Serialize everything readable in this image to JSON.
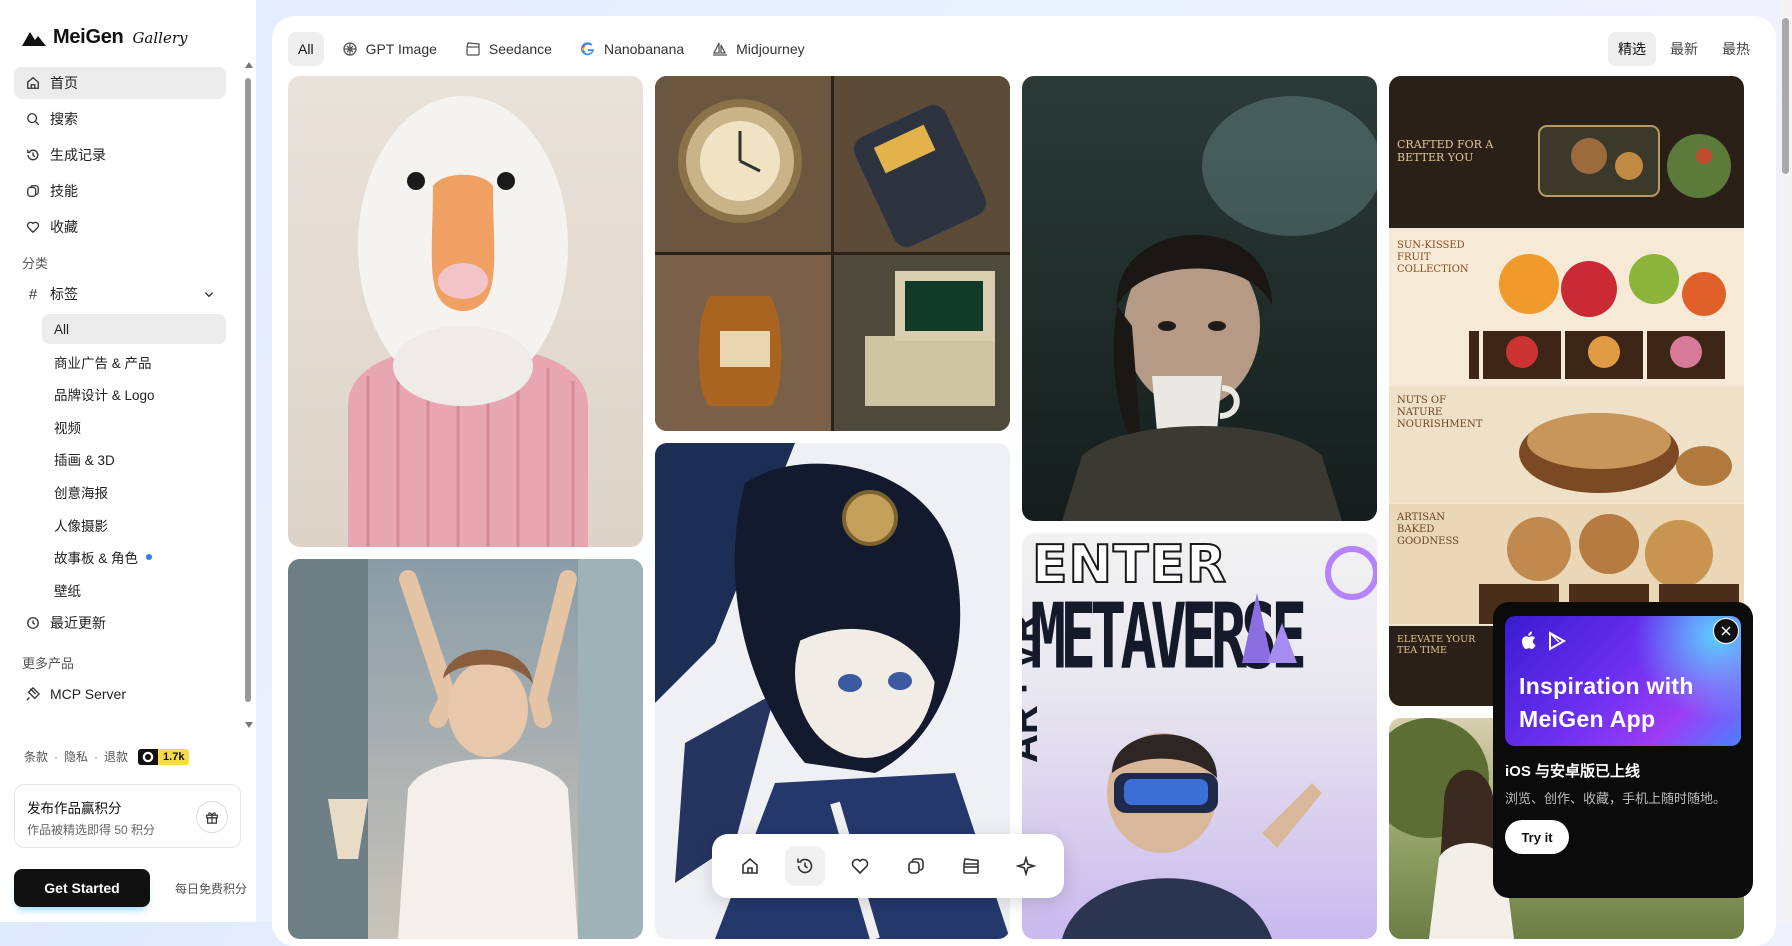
{
  "brand": {
    "name": "MeiGen",
    "tagline": "Gallery"
  },
  "nav": {
    "items": [
      {
        "label": "首页",
        "icon": "home-icon"
      },
      {
        "label": "搜索",
        "icon": "search-icon"
      },
      {
        "label": "生成记录",
        "icon": "history-icon"
      },
      {
        "label": "技能",
        "icon": "skills-icon"
      },
      {
        "label": "收藏",
        "icon": "heart-icon"
      }
    ],
    "category_label": "分类",
    "tags_label": "标签",
    "tags": [
      "All",
      "商业广告 & 产品",
      "品牌设计 & Logo",
      "视频",
      "插画 & 3D",
      "创意海报",
      "人像摄影",
      "故事板 & 角色",
      "壁纸"
    ],
    "recent_label": "最近更新",
    "more_label": "更多产品",
    "mcp_label": "MCP Server"
  },
  "footer": {
    "terms": "条款",
    "privacy": "隐私",
    "refund": "退款",
    "github_stars": "1.7k",
    "promo_title": "发布作品赢积分",
    "promo_sub": "作品被精选即得 50 积分",
    "get_started": "Get Started",
    "daily": "每日免费积分"
  },
  "filters": [
    "All",
    "GPT Image",
    "Seedance",
    "Nanobanana",
    "Midjourney"
  ],
  "sort": [
    "精选",
    "最新",
    "最热"
  ],
  "gallery": {
    "card3_headline_1": "ENTER",
    "card3_headline_2": "METAVERSE",
    "card3_side": "AR · VR",
    "card4_label_1": "CRAFTED FOR A BETTER YOU",
    "card4_label_2": "SUN-KISSED FRUIT COLLECTION",
    "card4_label_3": "NUTS OF NATURE NOURISHMENT",
    "card4_label_4": "ARTISAN BAKED GOODNESS",
    "card4_label_5": "ELEVATE YOUR TEA TIME"
  },
  "popup": {
    "banner": "Inspiration with MeiGen App",
    "title": "iOS 与安卓版已上线",
    "desc": "浏览、创作、收藏，手机上随时随地。",
    "button": "Try it"
  },
  "colors": {
    "accent": "#2f7bff",
    "github_badge": "#f7d94c"
  }
}
